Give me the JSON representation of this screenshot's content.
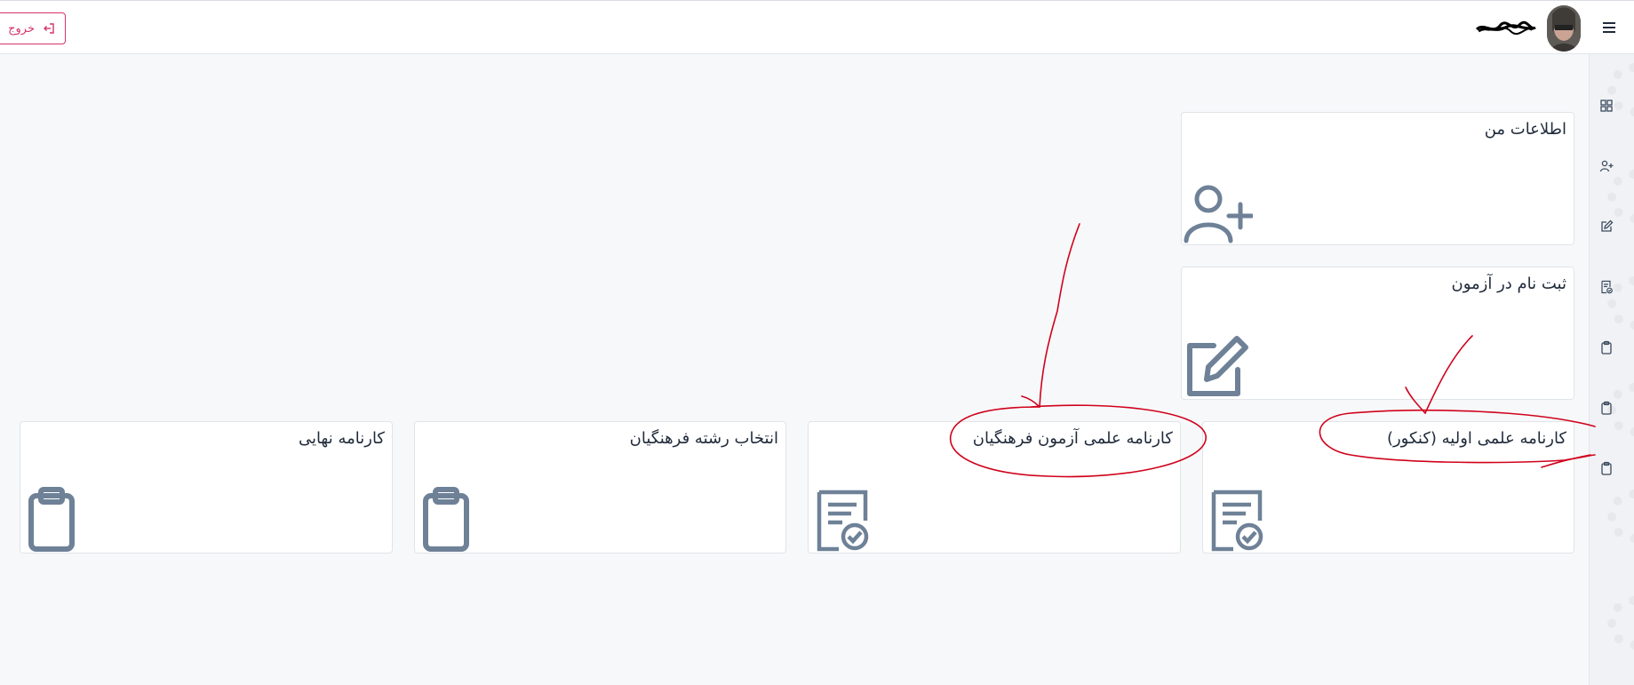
{
  "header": {
    "logout_label": "خروج",
    "icons": {
      "logout": "logout-icon",
      "menu": "hamburger-menu-icon",
      "avatar": "user-avatar"
    }
  },
  "sidebar": {
    "items": [
      {
        "icon": "dashboard-grid-icon"
      },
      {
        "icon": "user-plus-icon"
      },
      {
        "icon": "edit-icon"
      },
      {
        "icon": "report-check-icon"
      },
      {
        "icon": "clipboard-icon"
      },
      {
        "icon": "clipboard-icon"
      },
      {
        "icon": "clipboard-icon"
      }
    ]
  },
  "cards": {
    "my_info": {
      "title": "اطلاعات من",
      "icon": "user-plus-icon"
    },
    "exam_registration": {
      "title": "ثبت نام در آزمون",
      "icon": "edit-icon"
    },
    "initial_report_konkur": {
      "title": "کارنامه علمی اولیه (کنکور)",
      "icon": "report-check-icon"
    },
    "farhangian_report": {
      "title": "کارنامه علمی آزمون فرهنگیان",
      "icon": "report-check-icon"
    },
    "farhangian_field_selection": {
      "title": "انتخاب رشته فرهنگیان",
      "icon": "clipboard-icon"
    },
    "final_report": {
      "title": "کارنامه نهایی",
      "icon": "clipboard-icon"
    }
  },
  "colors": {
    "accent_logout": "#d6336c",
    "icon_gray": "#6e8197",
    "annotation_red": "#d0021b"
  }
}
